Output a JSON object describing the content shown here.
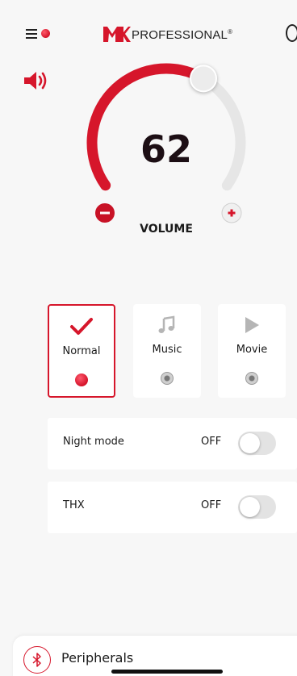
{
  "header": {
    "brand": "PROFESSIONAL",
    "brand_reg": "®"
  },
  "volume": {
    "value": "62",
    "label": "VOLUME",
    "level_fraction": 0.62
  },
  "modes": [
    {
      "label": "Normal",
      "icon": "check-icon",
      "selected": true
    },
    {
      "label": "Music",
      "icon": "music-note-icon",
      "selected": false
    },
    {
      "label": "Movie",
      "icon": "play-icon",
      "selected": false
    }
  ],
  "toggles": {
    "night_mode": {
      "label": "Night mode",
      "status": "OFF"
    },
    "thx": {
      "label": "THX",
      "status": "OFF"
    }
  },
  "bottom": {
    "label": "Peripherals",
    "icon": "bluetooth-icon"
  },
  "colors": {
    "accent": "#d6162b",
    "track": "#e6e6e6",
    "background": "#f7f7f7"
  }
}
